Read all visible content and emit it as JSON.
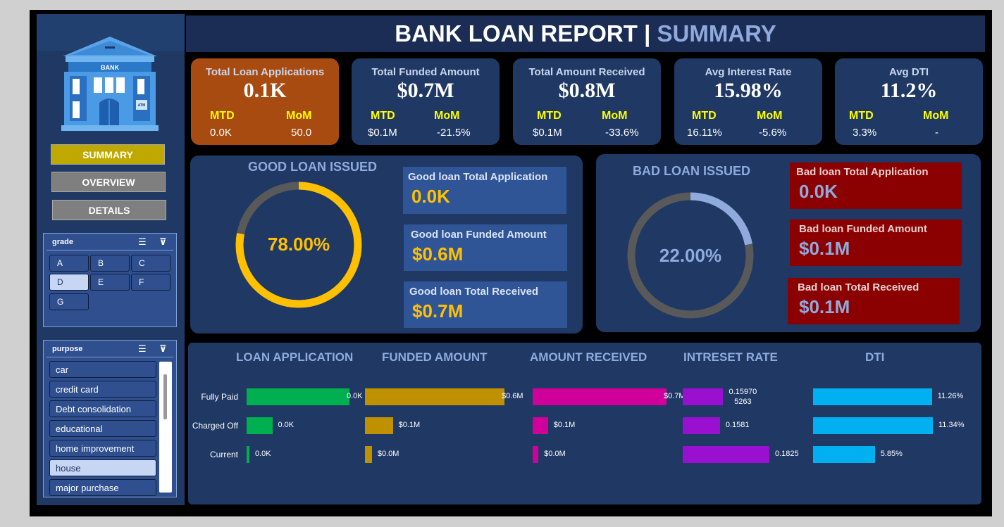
{
  "header": {
    "title": "BANK LOAN REPORT",
    "separator": "|",
    "subtitle": "SUMMARY"
  },
  "logo": {
    "sign": "BANK",
    "atm": "ATM"
  },
  "nav": {
    "summary": "SUMMARY",
    "overview": "OVERVIEW",
    "details": "DETAILS"
  },
  "grade_slicer": {
    "title": "grade",
    "items": [
      "A",
      "B",
      "C",
      "D",
      "E",
      "F",
      "G"
    ],
    "selected": "D"
  },
  "purpose_slicer": {
    "title": "purpose",
    "items": [
      "car",
      "credit card",
      "Debt consolidation",
      "educational",
      "home improvement",
      "house",
      "major purchase"
    ],
    "selected": "house"
  },
  "kpis": [
    {
      "title": "Total Loan Applications",
      "value": "0.1K",
      "mtd_label": "MTD",
      "mom_label": "MoM",
      "mtd": "0.0K",
      "mom": "50.0"
    },
    {
      "title": "Total Funded Amount",
      "value": "$0.7M",
      "mtd_label": "MTD",
      "mom_label": "MoM",
      "mtd": "$0.1M",
      "mom": "-21.5%"
    },
    {
      "title": "Total Amount Received",
      "value": "$0.8M",
      "mtd_label": "MTD",
      "mom_label": "MoM",
      "mtd": "$0.1M",
      "mom": "-33.6%"
    },
    {
      "title": "Avg Interest Rate",
      "value": "15.98%",
      "mtd_label": "MTD",
      "mom_label": "MoM",
      "mtd": "16.11%",
      "mom": "-5.6%"
    },
    {
      "title": "Avg DTI",
      "value": "11.2%",
      "mtd_label": "MTD",
      "mom_label": "MoM",
      "mtd": "3.3%",
      "mom": "-"
    }
  ],
  "good_loan": {
    "title": "GOOD LOAN ISSUED",
    "percent_label": "78.00%",
    "percent": 78,
    "boxes": [
      {
        "title": "Good loan Total Application",
        "value": "0.0K"
      },
      {
        "title": "Good loan Funded Amount",
        "value": "$0.6M"
      },
      {
        "title": "Good loan Total Received",
        "value": "$0.7M"
      }
    ]
  },
  "bad_loan": {
    "title": "BAD LOAN ISSUED",
    "percent_label": "22.00%",
    "percent": 22,
    "boxes": [
      {
        "title": "Bad loan Total Application",
        "value": "0.0K"
      },
      {
        "title": "Bad loan Funded Amount",
        "value": "$0.1M"
      },
      {
        "title": "Bad loan Total Received",
        "value": "$0.1M"
      }
    ]
  },
  "colors": {
    "good_ring": "#ffc000",
    "bad_ring": "#8faadc",
    "ring_track": "#595959",
    "app": "#00b050",
    "funded": "#bf9000",
    "received": "#d0009a",
    "interest": "#9a10d0",
    "dti": "#00b0f0"
  },
  "chart_data": {
    "type": "bar",
    "categories": [
      "Fully Paid",
      "Charged Off",
      "Current"
    ],
    "series": [
      {
        "name": "LOAN APPLICATION",
        "values": [
          0.08,
          0.02,
          0.001
        ],
        "labels": [
          "0.0K",
          "0.0K",
          "0.0K"
        ]
      },
      {
        "name": "FUNDED AMOUNT",
        "values": [
          0.6,
          0.12,
          0.03
        ],
        "labels": [
          "$0.6M",
          "$0.1M",
          "$0.0M"
        ]
      },
      {
        "name": "AMOUNT RECEIVED",
        "values": [
          0.7,
          0.08,
          0.03
        ],
        "labels": [
          "$0.7M",
          "$0.1M",
          "$0.0M"
        ]
      },
      {
        "name": "INTRESET RATE",
        "values": [
          0.1597,
          0.1581,
          0.1825
        ],
        "labels": [
          "0.15970\n5263",
          "0.1581",
          "0.1825"
        ]
      },
      {
        "name": "DTI",
        "values": [
          11.26,
          11.34,
          5.85
        ],
        "labels": [
          "11.26%",
          "11.34%",
          "5.85%"
        ]
      }
    ]
  }
}
